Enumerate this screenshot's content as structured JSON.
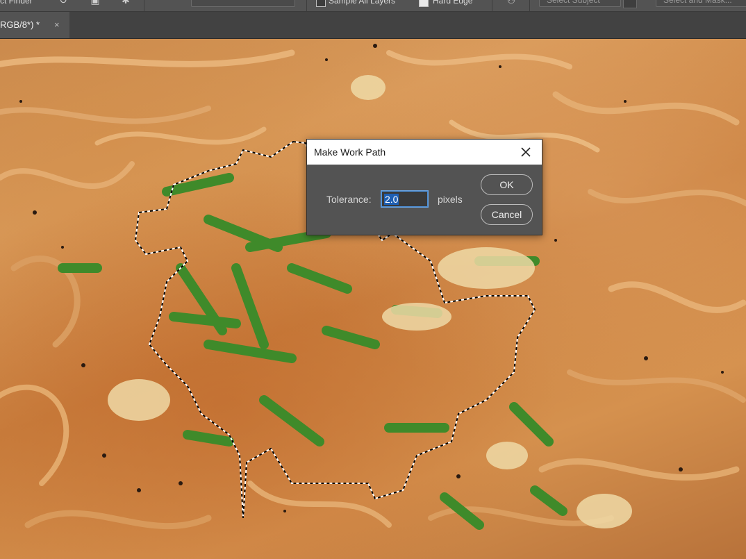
{
  "options_bar": {
    "edge_label": "ct Finder",
    "sample_all_layers_label": "Sample All Layers",
    "hard_edge_label": "Hard Edge",
    "select_subject_label": "Select Subject",
    "select_and_mask_label": "Select and Mask..."
  },
  "document_tab": {
    "title": "RGB/8*) *",
    "close_glyph": "×"
  },
  "dialog": {
    "title": "Make Work Path",
    "tolerance_label": "Tolerance:",
    "tolerance_value": "2.0",
    "units_label": "pixels",
    "ok_label": "OK",
    "cancel_label": "Cancel"
  },
  "icons": {
    "close": "close-icon",
    "rotate": "rotate-icon",
    "sample": "sample-icon",
    "gear": "gear-icon",
    "refine": "refine-icon"
  },
  "colors": {
    "panel": "#535353",
    "tabstrip": "#424242",
    "selection_blue": "#1e5fb3",
    "chive_green": "#3f8a2a"
  }
}
